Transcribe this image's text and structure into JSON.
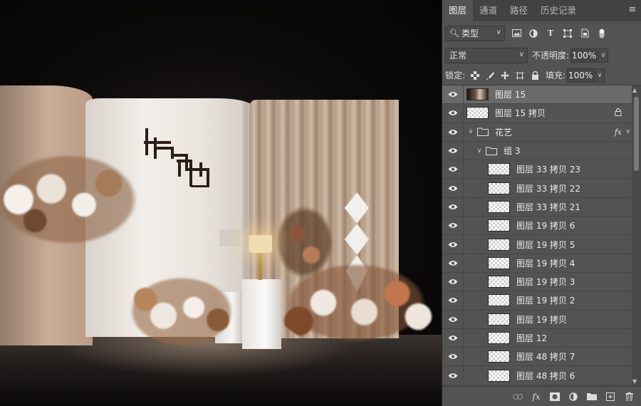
{
  "colors": {
    "panel_bg": "#535353",
    "tab_bg": "#424242",
    "selected_row": "#6a6a6a"
  },
  "tabs": [
    {
      "label": "图层",
      "active": true
    },
    {
      "label": "通道"
    },
    {
      "label": "路径"
    },
    {
      "label": "历史记录"
    }
  ],
  "filter": {
    "kind_label": "类型"
  },
  "blend": {
    "mode": "正常",
    "opacity_label": "不透明度:",
    "opacity_value": "100%"
  },
  "lock": {
    "label": "锁定:",
    "fill_label": "填充:",
    "fill_value": "100%"
  },
  "layers": [
    {
      "name": "图层 15",
      "indent": 0,
      "thumb": "photo",
      "selected": true
    },
    {
      "name": "图层 15 拷贝",
      "indent": 0,
      "thumb": "transparent",
      "locked": true
    },
    {
      "name": "花艺",
      "indent": 0,
      "type": "group",
      "fx": "fx"
    },
    {
      "name": "组 3",
      "indent": 1,
      "type": "group"
    },
    {
      "name": "图层 33 拷贝 23",
      "indent": 2
    },
    {
      "name": "图层 33 拷贝 22",
      "indent": 2
    },
    {
      "name": "图层 33 拷贝 21",
      "indent": 2
    },
    {
      "name": "图层 19 拷贝 6",
      "indent": 2
    },
    {
      "name": "图层 19 拷贝 5",
      "indent": 2
    },
    {
      "name": "图层 19 拷贝 4",
      "indent": 2
    },
    {
      "name": "图层 19 拷贝 3",
      "indent": 2
    },
    {
      "name": "图层 19 拷贝 2",
      "indent": 2
    },
    {
      "name": "图层 19 拷贝",
      "indent": 2
    },
    {
      "name": "图层 12",
      "indent": 2
    },
    {
      "name": "图层 48 拷贝 7",
      "indent": 2
    },
    {
      "name": "图层 48 拷贝 6",
      "indent": 2
    }
  ],
  "bottom_icons": [
    "link-icon",
    "fx-icon",
    "mask-icon",
    "adjustment-icon",
    "folder-icon",
    "new-layer-icon",
    "trash-icon"
  ],
  "bottom_fx_label": "fx"
}
